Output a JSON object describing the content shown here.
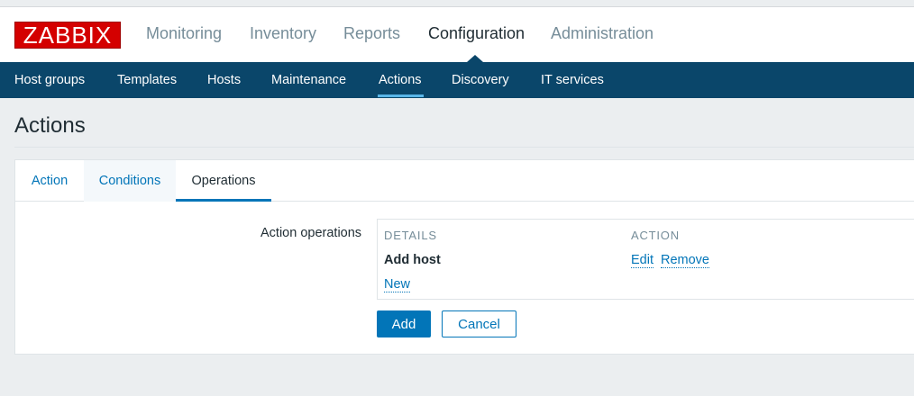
{
  "logo": {
    "text": "ZABBIX"
  },
  "main_nav": {
    "items": [
      "Monitoring",
      "Inventory",
      "Reports",
      "Configuration",
      "Administration"
    ],
    "active": "Configuration"
  },
  "sub_nav": {
    "items": [
      "Host groups",
      "Templates",
      "Hosts",
      "Maintenance",
      "Actions",
      "Discovery",
      "IT services"
    ],
    "active": "Actions"
  },
  "page": {
    "title": "Actions"
  },
  "tabs": {
    "action": "Action",
    "conditions": "Conditions",
    "operations": "Operations",
    "active": "Operations"
  },
  "form": {
    "label": "Action operations",
    "table": {
      "headers": {
        "details": "DETAILS",
        "action": "ACTION"
      },
      "rows": [
        {
          "details": "Add host",
          "edit": "Edit",
          "remove": "Remove"
        }
      ],
      "new_link": "New"
    },
    "buttons": {
      "add": "Add",
      "cancel": "Cancel"
    }
  },
  "colors": {
    "brand_red": "#d40000",
    "subnav_bg": "#0a466a",
    "accent_blue": "#0275b8",
    "active_underline": "#59b6e8"
  }
}
